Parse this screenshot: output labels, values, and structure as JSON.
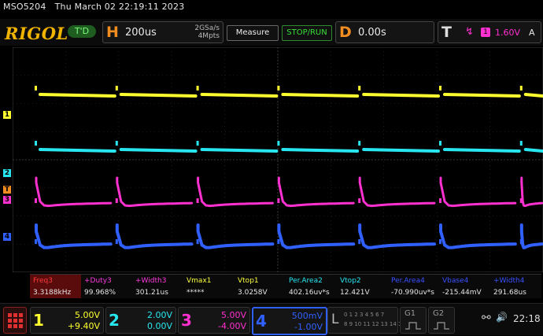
{
  "header": {
    "model": "MSO5204",
    "datetime": "Thu March 02 22:19:11 2023",
    "brand": "RIGOL",
    "run_state": "T'D"
  },
  "horizontal": {
    "letter": "H",
    "timebase": "200us",
    "sample_rate": "2GSa/s",
    "memory": "4Mpts"
  },
  "buttons": {
    "measure": "Measure",
    "stop_run": "STOP/RUN"
  },
  "delay": {
    "letter": "D",
    "value": "0.00s"
  },
  "trigger": {
    "letter": "T",
    "source_label": "1",
    "level": "1.60V",
    "mode": "A"
  },
  "measurements": [
    {
      "name": "Freq3",
      "value": "3.3188kHz",
      "color": "#ff3a3a"
    },
    {
      "name": "+Duty3",
      "value": "99.968%",
      "color": "#ff3adf"
    },
    {
      "name": "+Width3",
      "value": "301.21us",
      "color": "#ff3adf"
    },
    {
      "name": "Vmax1",
      "value": "*****",
      "color": "#ffff40"
    },
    {
      "name": "Vtop1",
      "value": "3.0258V",
      "color": "#ffff40"
    },
    {
      "name": "Per.Area2",
      "value": "402.16uv*s",
      "color": "#28e6f0"
    },
    {
      "name": "Vtop2",
      "value": "12.421V",
      "color": "#28e6f0"
    },
    {
      "name": "Per.Area4",
      "value": "-70.990uv*s",
      "color": "#3850ff"
    },
    {
      "name": "Vbase4",
      "value": "-215.44mV",
      "color": "#3850ff"
    },
    {
      "name": "+Width4",
      "value": "291.68us",
      "color": "#3850ff"
    }
  ],
  "channels": [
    {
      "num": "1",
      "scale": "5.00V",
      "offset": "+9.40V",
      "color": "#ffff30"
    },
    {
      "num": "2",
      "scale": "2.00V",
      "offset": "0.00V",
      "color": "#28e6f0"
    },
    {
      "num": "3",
      "scale": "5.00V",
      "offset": "-4.00V",
      "color": "#ff30d0"
    },
    {
      "num": "4",
      "scale": "500mV",
      "offset": "-1.00V",
      "color": "#3060ff"
    }
  ],
  "logic": {
    "letter": "L",
    "row1": "0 1 2 3  4 5 6 7",
    "row2": "8 9 10 11 12 13 14 15"
  },
  "gi": [
    "G1",
    "G2"
  ],
  "clock": "22:18",
  "markers": {
    "ch1": "1",
    "ch2": "2",
    "ch3": "3",
    "ch4": "4",
    "trig": "T"
  },
  "colors": {
    "ch1": "#ffff30",
    "ch2": "#28e6f0",
    "ch3": "#ff30d0",
    "ch4": "#3060ff",
    "orange": "#f08c20"
  },
  "icons": [
    "usb-icon",
    "speaker-icon",
    "menu-grid-icon",
    "trigger-edge-icon"
  ]
}
